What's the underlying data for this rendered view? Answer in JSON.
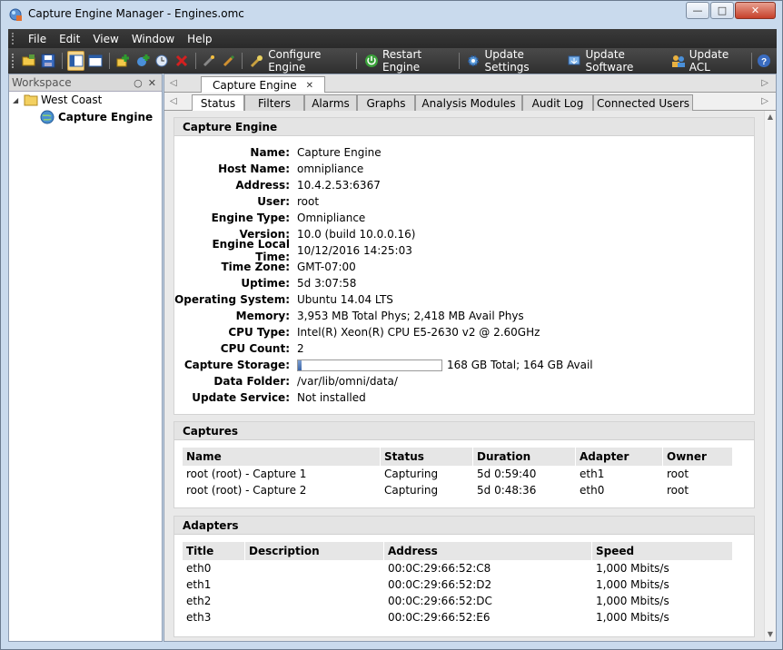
{
  "window": {
    "title": "Capture Engine Manager - Engines.omc"
  },
  "menu": [
    "File",
    "Edit",
    "View",
    "Window",
    "Help"
  ],
  "toolbar": {
    "configure_engine": "Configure Engine",
    "restart_engine": "Restart Engine",
    "update_settings": "Update Settings",
    "update_software": "Update Software",
    "update_acl": "Update ACL"
  },
  "workspace": {
    "title": "Workspace",
    "group": "West Coast",
    "engine": "Capture Engine"
  },
  "doc_tab": "Capture Engine",
  "tabs": [
    "Status",
    "Filters",
    "Alarms",
    "Graphs",
    "Analysis Modules",
    "Audit Log",
    "Connected Users"
  ],
  "engine_section": {
    "title": "Capture Engine",
    "fields": [
      {
        "label": "Name:",
        "value": "Capture Engine"
      },
      {
        "label": "Host Name:",
        "value": "omnipliance"
      },
      {
        "label": "Address:",
        "value": "10.4.2.53:6367"
      },
      {
        "label": "User:",
        "value": "root"
      },
      {
        "label": "Engine Type:",
        "value": "Omnipliance"
      },
      {
        "label": "Version:",
        "value": "10.0 (build 10.0.0.16)"
      },
      {
        "label": "Engine Local Time:",
        "value": "10/12/2016 14:25:03"
      },
      {
        "label": "Time Zone:",
        "value": "GMT-07:00"
      },
      {
        "label": "Uptime:",
        "value": "5d 3:07:58"
      },
      {
        "label": "Operating System:",
        "value": "Ubuntu 14.04 LTS"
      },
      {
        "label": "Memory:",
        "value": "3,953 MB Total Phys; 2,418 MB Avail Phys"
      },
      {
        "label": "CPU Type:",
        "value": "Intel(R) Xeon(R) CPU E5-2630 v2 @ 2.60GHz"
      },
      {
        "label": "CPU Count:",
        "value": "2"
      },
      {
        "label": "Capture Storage:",
        "value": "168 GB Total; 164 GB Avail"
      },
      {
        "label": "Data Folder:",
        "value": "/var/lib/omni/data/"
      },
      {
        "label": "Update Service:",
        "value": "Not installed"
      }
    ],
    "storage_used_fraction": 0.024
  },
  "captures": {
    "title": "Captures",
    "columns": [
      "Name",
      "Status",
      "Duration",
      "Adapter",
      "Owner"
    ],
    "rows": [
      [
        "root (root) - Capture 1",
        "Capturing",
        "5d 0:59:40",
        "eth1",
        "root"
      ],
      [
        "root (root) - Capture 2",
        "Capturing",
        "5d 0:48:36",
        "eth0",
        "root"
      ]
    ]
  },
  "adapters": {
    "title": "Adapters",
    "columns": [
      "Title",
      "Description",
      "Address",
      "Speed"
    ],
    "rows": [
      [
        "eth0",
        "",
        "00:0C:29:66:52:C8",
        "1,000 Mbits/s"
      ],
      [
        "eth1",
        "",
        "00:0C:29:66:52:D2",
        "1,000 Mbits/s"
      ],
      [
        "eth2",
        "",
        "00:0C:29:66:52:DC",
        "1,000 Mbits/s"
      ],
      [
        "eth3",
        "",
        "00:0C:29:66:52:E6",
        "1,000 Mbits/s"
      ]
    ]
  }
}
